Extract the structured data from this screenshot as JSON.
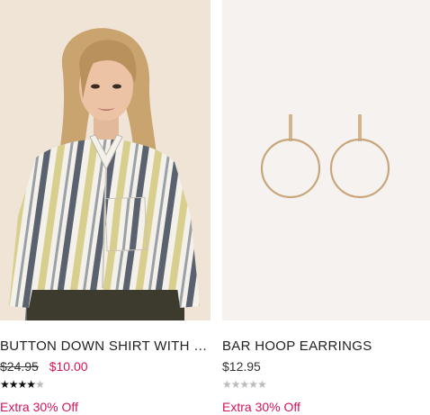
{
  "products": [
    {
      "name": "BUTTON DOWN SHIRT WITH P...",
      "original_price": "$24.95",
      "sale_price": "$10.00",
      "rating": 4,
      "rating_max": 5,
      "promo": "Extra 30% Off"
    },
    {
      "name": "BAR HOOP EARRINGS",
      "price": "$12.95",
      "rating": 0,
      "rating_max": 5,
      "promo": "Extra 30% Off"
    }
  ],
  "colors": {
    "sale": "#d4145a",
    "promo": "#d4145a",
    "star_on": "#111111",
    "star_off": "#bcbcbc"
  }
}
